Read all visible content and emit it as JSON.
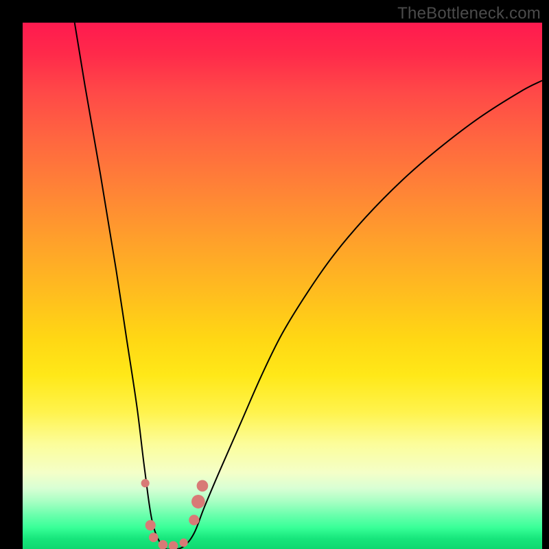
{
  "watermark": "TheBottleneck.com",
  "colors": {
    "frame": "#000000",
    "curve": "#000000",
    "markers": "#d87a76",
    "gradient_top": "#ff1a4f",
    "gradient_bottom": "#0fd870"
  },
  "chart_data": {
    "type": "line",
    "title": "",
    "xlabel": "",
    "ylabel": "",
    "xlim": [
      0,
      100
    ],
    "ylim": [
      0,
      100
    ],
    "note": "No axis tick labels are rendered; values are estimated on a 0–100 percentage scale for both axes based on visual position. y-axis runs top (100) to bottom (0).",
    "series": [
      {
        "name": "bottleneck-curve",
        "x": [
          10,
          12,
          15,
          18,
          20,
          22,
          23.5,
          25,
          27,
          29,
          31,
          33,
          35,
          38,
          42,
          46,
          50,
          55,
          60,
          66,
          73,
          80,
          88,
          96,
          100
        ],
        "y": [
          100,
          88,
          71,
          53,
          40,
          27,
          15,
          5,
          0.5,
          0,
          0.5,
          3,
          8,
          15,
          24,
          33,
          41,
          49,
          56,
          63,
          70,
          76,
          82,
          87,
          89
        ]
      }
    ],
    "markers": [
      {
        "x": 23.6,
        "y": 12.5,
        "r": 0.8
      },
      {
        "x": 24.6,
        "y": 4.5,
        "r": 1.0
      },
      {
        "x": 25.2,
        "y": 2.2,
        "r": 0.9
      },
      {
        "x": 27.0,
        "y": 0.8,
        "r": 0.9
      },
      {
        "x": 29.0,
        "y": 0.6,
        "r": 0.9
      },
      {
        "x": 31.0,
        "y": 1.2,
        "r": 0.8
      },
      {
        "x": 33.0,
        "y": 5.5,
        "r": 1.0
      },
      {
        "x": 33.8,
        "y": 9.0,
        "r": 1.3
      },
      {
        "x": 34.6,
        "y": 12.0,
        "r": 1.1
      }
    ]
  }
}
